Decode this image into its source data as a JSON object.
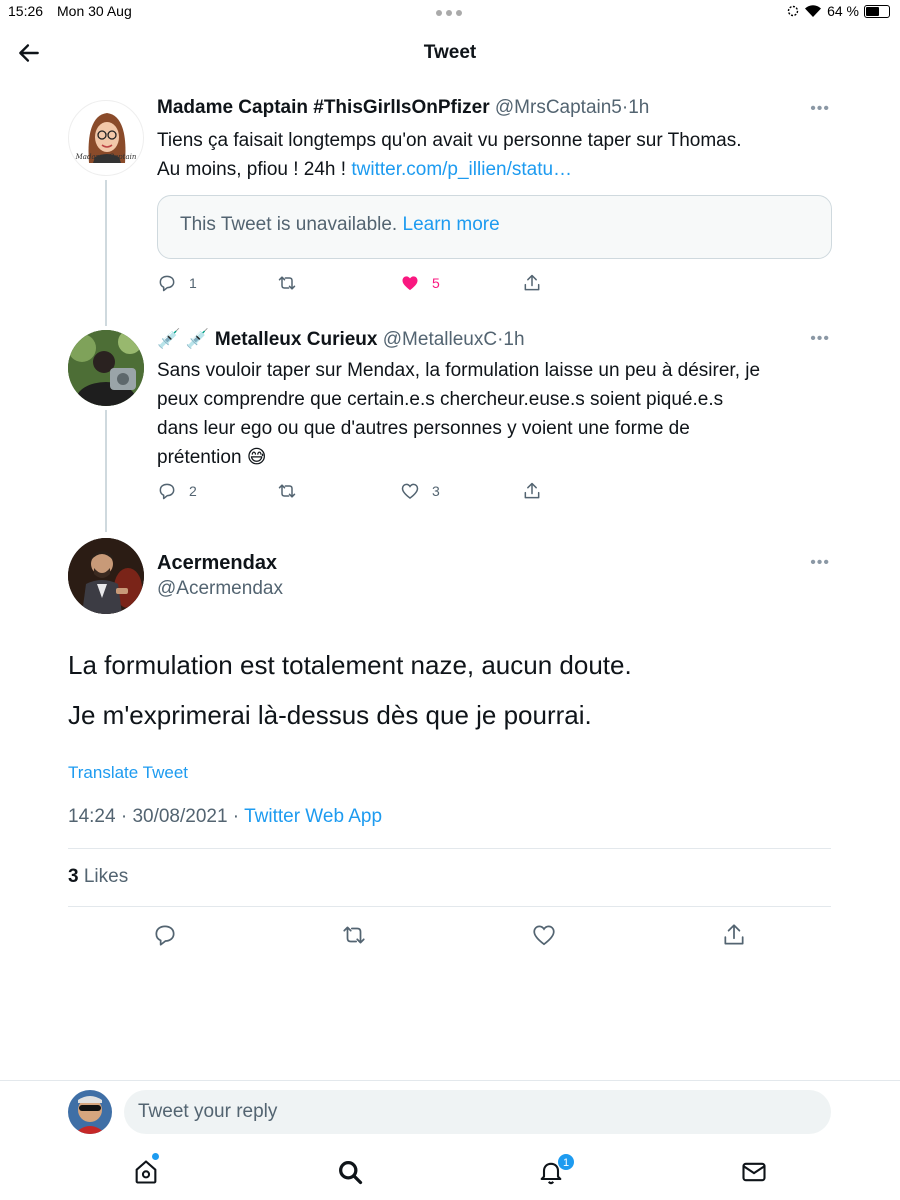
{
  "status_bar": {
    "time": "15:26",
    "date": "Mon 30 Aug",
    "battery": "64 %",
    "battery_level": 0.64
  },
  "header": {
    "title": "Tweet"
  },
  "thread": [
    {
      "name": "Madame Captain #ThisGirlIsOnPfizer",
      "handle": "@MrsCaptain5",
      "time": "1h",
      "text_lines": [
        "Tiens ça faisait longtemps qu'on avait vu personne taper sur Thomas.",
        "Au moins, pfiou ! 24h ! "
      ],
      "link": "twitter.com/p_illien/statu…",
      "avatar_text": "Madame Captain",
      "quote": {
        "text": "This Tweet is unavailable.",
        "link": "Learn more"
      },
      "replies": "1",
      "retweets": "",
      "likes": "5",
      "liked": true
    },
    {
      "name_prefix": "💉 💉",
      "name": "Metalleux Curieux",
      "handle": "@MetalleuxC",
      "time": "1h",
      "text_lines": [
        "Sans vouloir taper sur Mendax, la formulation laisse un peu à désirer, je",
        "peux comprendre que certain.e.s chercheur.euse.s soient piqué.e.s",
        "dans leur ego ou que d'autres personnes y voient une forme de",
        "prétention 😅"
      ],
      "replies": "2",
      "retweets": "",
      "likes": "3",
      "liked": false
    }
  ],
  "main_tweet": {
    "name": "Acermendax",
    "handle": "@Acermendax",
    "text_lines": [
      "La formulation est totalement naze, aucun doute.",
      "Je m'exprimerai là-dessus dès que je pourrai."
    ],
    "translate": "Translate Tweet",
    "time": "14:24",
    "date": "30/08/2021",
    "app": "Twitter Web App",
    "likes_count": "3",
    "likes_label": "Likes"
  },
  "reply": {
    "placeholder": "Tweet your reply"
  },
  "nav": {
    "notifications_badge": "1"
  },
  "colors": {
    "accent": "#1d9bf0",
    "like": "#f91880",
    "secondary": "#536471"
  }
}
